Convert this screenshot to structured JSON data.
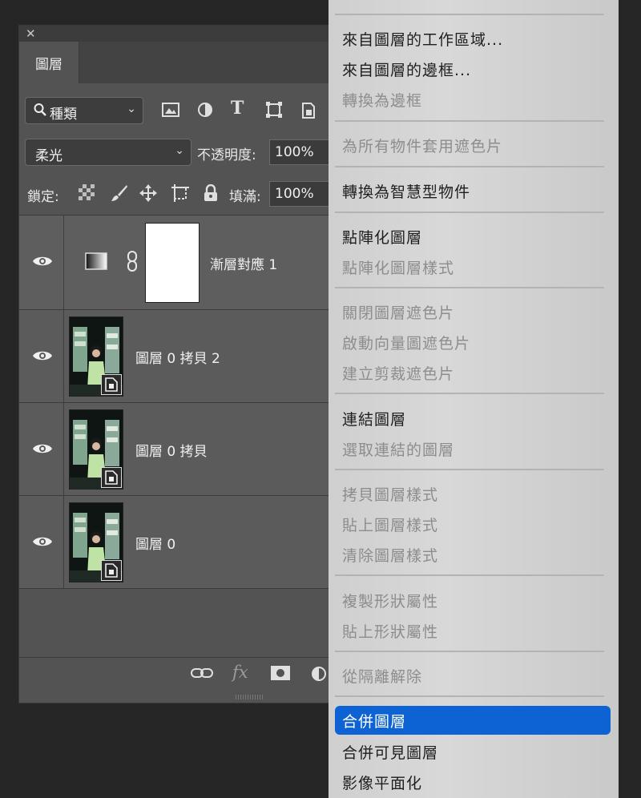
{
  "panel": {
    "tab_label": "圖層",
    "filter": {
      "label": "種類",
      "icons": [
        "image-filter-icon",
        "adjustment-filter-icon",
        "type-filter-icon",
        "shape-filter-icon",
        "smart-object-filter-icon"
      ]
    },
    "blend_mode": "柔光",
    "opacity_label": "不透明度:",
    "opacity_value": "100%",
    "lock_label": "鎖定:",
    "fill_label": "填滿:",
    "fill_value": "100%",
    "layers": [
      {
        "name": "漸層對應 1",
        "type": "adjustment"
      },
      {
        "name": "圖層 0 拷貝 2",
        "type": "smart-object"
      },
      {
        "name": "圖層 0 拷貝",
        "type": "smart-object"
      },
      {
        "name": "圖層 0",
        "type": "smart-object"
      }
    ],
    "footer_icons": [
      "link-layers-icon",
      "fx-icon",
      "mask-icon",
      "adjustment-icon"
    ],
    "footer_fx_label": "fx"
  },
  "menu": {
    "items": [
      {
        "label": "來自圖層的工作區域...",
        "enabled": true
      },
      {
        "label": "來自圖層的邊框...",
        "enabled": true
      },
      {
        "label": "轉換為邊框",
        "enabled": false
      },
      {
        "label": "為所有物件套用遮色片",
        "enabled": false
      },
      {
        "label": "轉換為智慧型物件",
        "enabled": true
      },
      {
        "label": "點陣化圖層",
        "enabled": true
      },
      {
        "label": "點陣化圖層樣式",
        "enabled": false
      },
      {
        "label": "關閉圖層遮色片",
        "enabled": false
      },
      {
        "label": "啟動向量圖遮色片",
        "enabled": false
      },
      {
        "label": "建立剪裁遮色片",
        "enabled": false
      },
      {
        "label": "連結圖層",
        "enabled": true
      },
      {
        "label": "選取連結的圖層",
        "enabled": false
      },
      {
        "label": "拷貝圖層樣式",
        "enabled": false
      },
      {
        "label": "貼上圖層樣式",
        "enabled": false
      },
      {
        "label": "清除圖層樣式",
        "enabled": false
      },
      {
        "label": "複製形狀屬性",
        "enabled": false
      },
      {
        "label": "貼上形狀屬性",
        "enabled": false
      },
      {
        "label": "從隔離解除",
        "enabled": false
      },
      {
        "label": "合併圖層",
        "enabled": true,
        "highlighted": true
      },
      {
        "label": "合併可見圖層",
        "enabled": true
      },
      {
        "label": "影像平面化",
        "enabled": true
      }
    ]
  },
  "colors": {
    "panel_bg": "#535353",
    "menu_bg": "#d0d0d0",
    "highlight": "#0d63d4"
  }
}
